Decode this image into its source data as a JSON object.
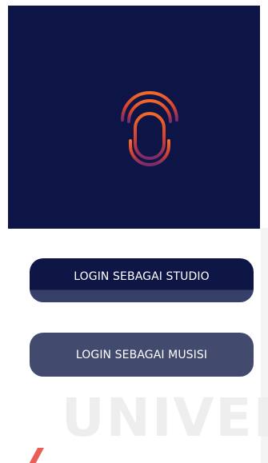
{
  "hero": {
    "background": "#0c1545",
    "logo_icon": "microphone-broadcast-icon",
    "logo_colors": [
      "#f26a2a",
      "#d6402f",
      "#7a2a6e"
    ]
  },
  "buttons": {
    "studio_label": "LOGIN SEBAGAI STUDIO",
    "musisi_label": "LOGIN SEBAGAI MUSISI"
  },
  "watermark": {
    "text": "UNIVER",
    "accent_color": "#e8423a"
  }
}
